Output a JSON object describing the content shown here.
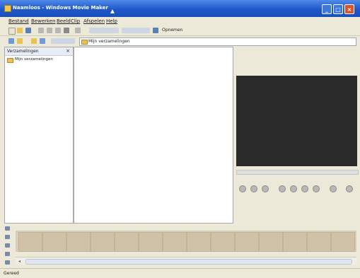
{
  "window": {
    "title": "Naamloos - Windows Movie Maker",
    "controls": {
      "minimize": "_",
      "maximize": "□",
      "close": "×"
    }
  },
  "menu": {
    "items": [
      "Bestand",
      "Bewerken",
      "Beeld",
      "Clip",
      "Afspelen",
      "Help"
    ]
  },
  "toolbar": {
    "record_label": "Opnemen"
  },
  "location": {
    "value": "Mijn verzamelingen"
  },
  "left_pane": {
    "title": "Verzamelingen",
    "close_glyph": "×",
    "tree_item": "Mijn verzamelingen"
  },
  "status": {
    "text": "Gereed"
  },
  "colors": {
    "titlebar": "#1f57c9",
    "preview_screen": "#2a2a2a",
    "storyboard": "#d9cdb6"
  }
}
